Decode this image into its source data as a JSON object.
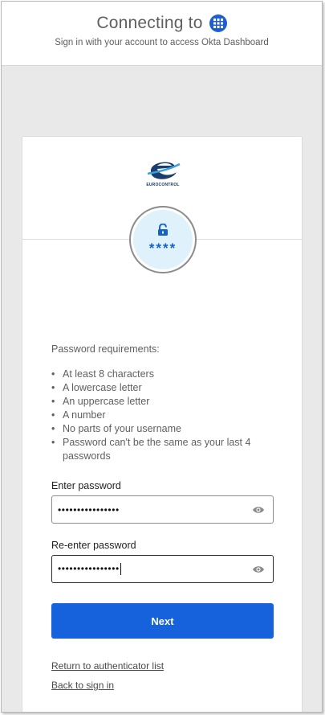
{
  "header": {
    "title": "Connecting to",
    "subtitle": "Sign in with your account to access Okta Dashboard",
    "app_icon": "app-grid-icon"
  },
  "logo": {
    "text": "EUROCONTROL"
  },
  "authenticator": {
    "icon": "password-lock-icon",
    "stars": "****"
  },
  "requirements": {
    "title": "Password requirements:",
    "items": [
      "At least 8 characters",
      "A lowercase letter",
      "An uppercase letter",
      "A number",
      "No parts of your username",
      "Password can't be the same as your last 4 passwords"
    ]
  },
  "form": {
    "password_label": "Enter password",
    "password_value": "••••••••••••••••",
    "reenter_label": "Re-enter password",
    "reenter_value": "••••••••••••••••",
    "submit_label": "Next"
  },
  "links": {
    "authenticator_list": "Return to authenticator list",
    "back_to_sign_in": "Back to sign in"
  },
  "colors": {
    "primary": "#1662dd",
    "badge_bg": "#dff2fb",
    "accent_icon": "#1d5fd1"
  }
}
